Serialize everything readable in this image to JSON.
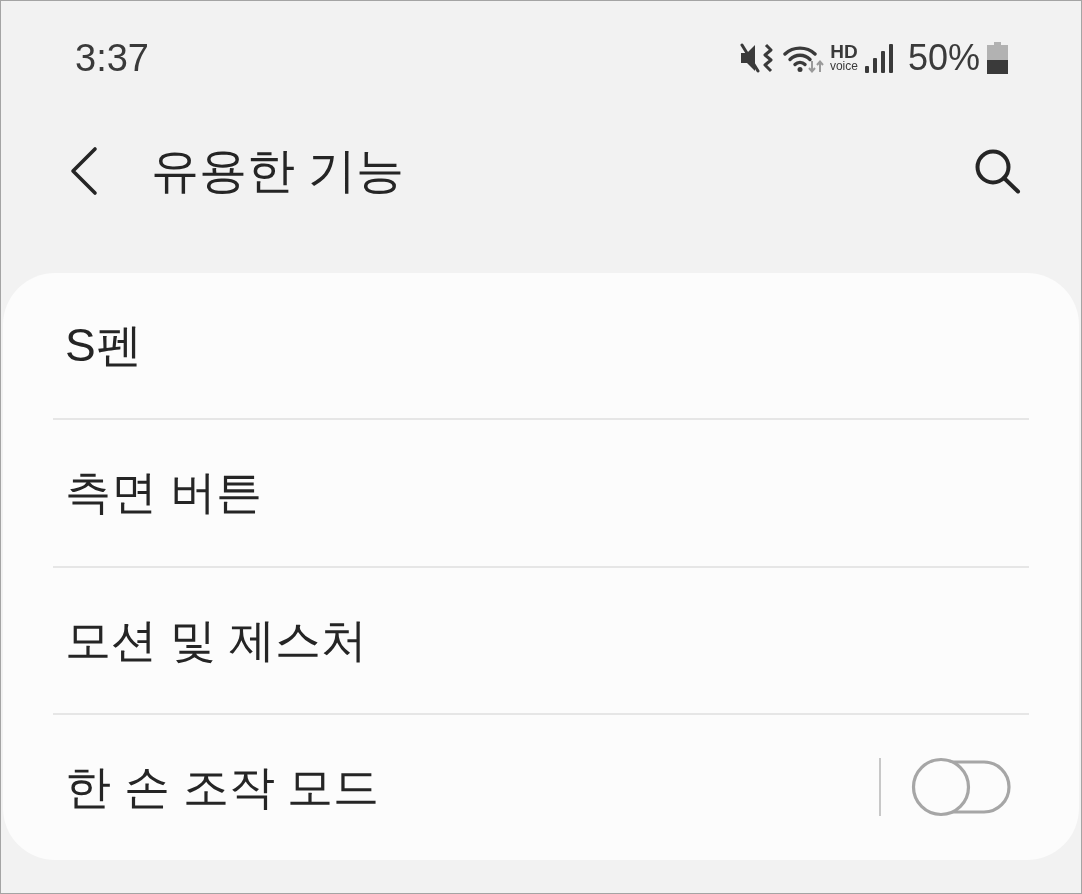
{
  "status_bar": {
    "time": "3:37",
    "hd_label": "HD",
    "voice_label": "voice",
    "battery_percent": "50%"
  },
  "header": {
    "title": "유용한 기능"
  },
  "items": [
    {
      "label": "S펜",
      "kind": "link"
    },
    {
      "label": "측면 버튼",
      "kind": "link"
    },
    {
      "label": "모션 및 제스처",
      "kind": "link"
    },
    {
      "label": "한 손 조작 모드",
      "kind": "switch",
      "on": false
    }
  ]
}
